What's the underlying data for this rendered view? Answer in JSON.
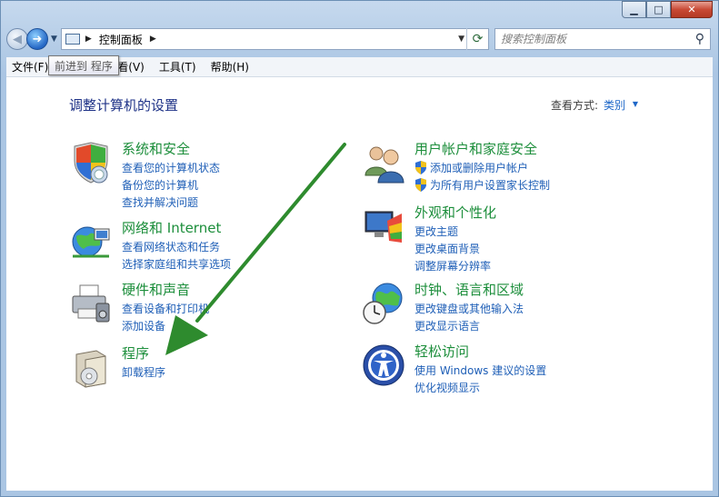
{
  "caption": {
    "minimize": "▁",
    "maximize": "□",
    "close": "✕"
  },
  "nav": {
    "back_glyph": "◀",
    "forward_glyph": "➜",
    "history_glyph": "▼",
    "crumbs": [
      "控制面板"
    ],
    "crumb_sep": "▶",
    "dropdown_glyph": "▼",
    "refresh_glyph": "⟳"
  },
  "search": {
    "placeholder": "搜索控制面板",
    "icon": "search-icon"
  },
  "menu": {
    "file": "文件(F)",
    "view": "查看(V)",
    "tools": "工具(T)",
    "help": "帮助(H)"
  },
  "tooltip": "前进到 程序",
  "content": {
    "title": "调整计算机的设置",
    "view_by_label": "查看方式:",
    "view_by_value": "类别"
  },
  "categories": [
    {
      "id": "system-security",
      "title": "系统和安全",
      "icon": "shield-icon",
      "links": [
        "查看您的计算机状态",
        "备份您的计算机",
        "查找并解决问题"
      ]
    },
    {
      "id": "network",
      "title": "网络和 Internet",
      "icon": "globe-network-icon",
      "links": [
        "查看网络状态和任务",
        "选择家庭组和共享选项"
      ]
    },
    {
      "id": "hardware",
      "title": "硬件和声音",
      "icon": "printer-icon",
      "links": [
        "查看设备和打印机",
        "添加设备"
      ]
    },
    {
      "id": "programs",
      "title": "程序",
      "icon": "programs-box-icon",
      "links": [
        "卸载程序"
      ]
    },
    {
      "id": "user-accounts",
      "title": "用户帐户和家庭安全",
      "icon": "users-icon",
      "links": [
        "添加或删除用户帐户",
        "为所有用户设置家长控制"
      ]
    },
    {
      "id": "appearance",
      "title": "外观和个性化",
      "icon": "appearance-icon",
      "links": [
        "更改主题",
        "更改桌面背景",
        "调整屏幕分辨率"
      ]
    },
    {
      "id": "clock-region",
      "title": "时钟、语言和区域",
      "icon": "clock-globe-icon",
      "links": [
        "更改键盘或其他输入法",
        "更改显示语言"
      ]
    },
    {
      "id": "ease-access",
      "title": "轻松访问",
      "icon": "ease-of-access-icon",
      "links": [
        "使用 Windows 建议的设置",
        "优化视频显示"
      ]
    }
  ],
  "colors": {
    "link": "#1f5fb7",
    "category_title": "#1c8e3b",
    "heading": "#1e3287",
    "annotation_arrow": "#2e8b2e"
  }
}
